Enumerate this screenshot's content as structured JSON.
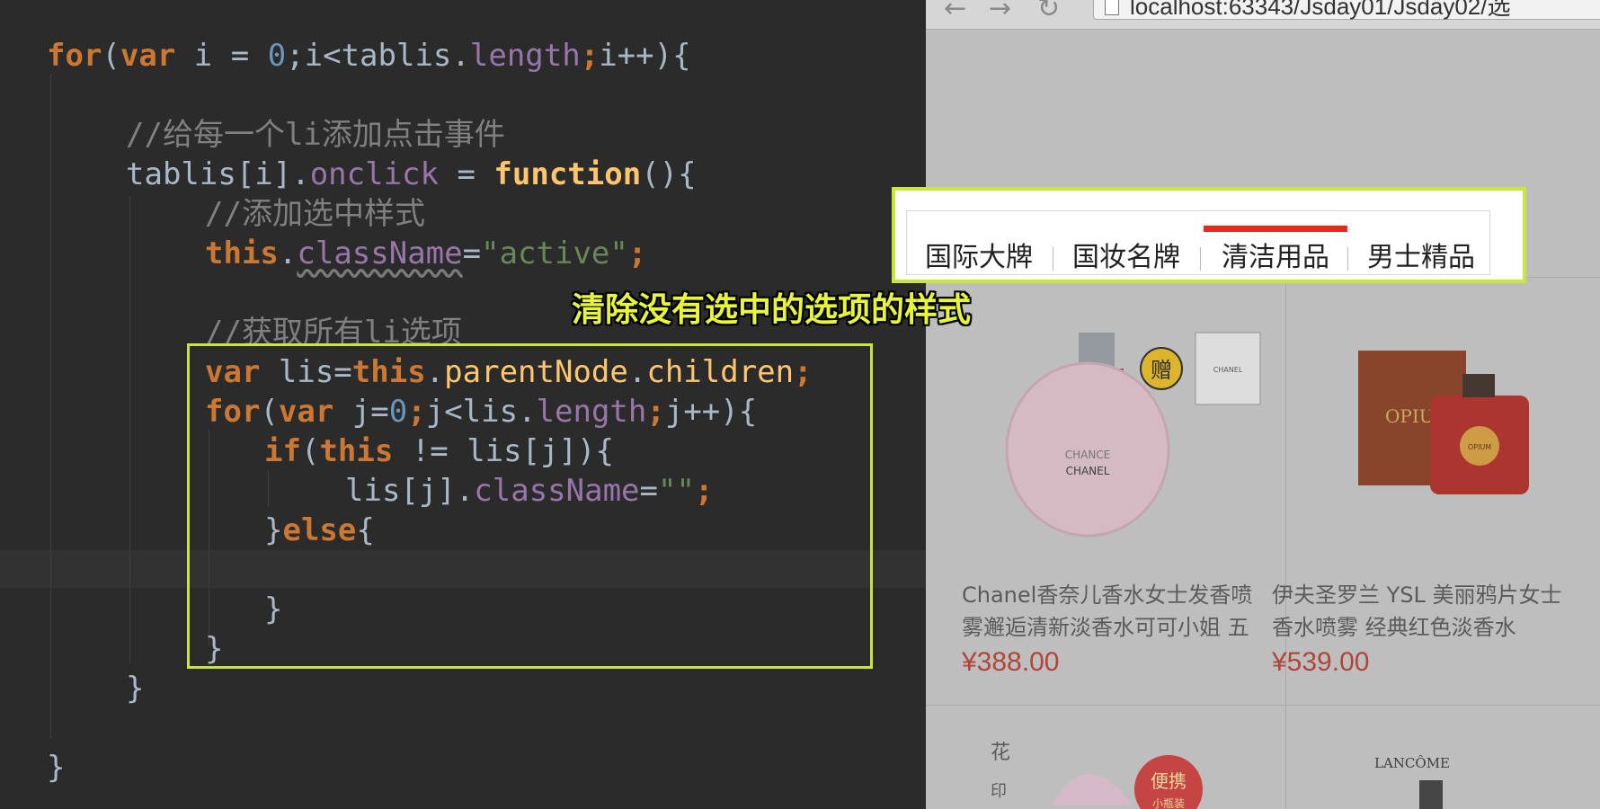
{
  "code_lines": [
    [
      "for(var i = 0;i<tablis.length;i++){"
    ],
    [
      "//给每一个li添加点击事件"
    ],
    [
      "tablis[i].onclick = function(){"
    ],
    [
      "//添加选中样式"
    ],
    [
      "this.className=\"active\";"
    ],
    [
      "//获取所有li选项"
    ],
    [
      "var lis=this.parentNode.children;"
    ],
    [
      "for(var j=0;j<lis.length;j++){"
    ],
    [
      "if(this != lis[j]){"
    ],
    [
      "lis[j].className=\"\";"
    ],
    [
      "}else{"
    ],
    [
      "}"
    ],
    [
      "}"
    ],
    [
      "}"
    ],
    [
      "}"
    ]
  ],
  "tokens": {
    "l1": [
      "for",
      "(",
      "var",
      " i = ",
      "0",
      ";i<tablis.",
      "length",
      ";",
      "i++){"
    ],
    "l2": [
      "//给每一个li添加点击事件"
    ],
    "l3": [
      "tablis[i].",
      "onclick",
      " = ",
      "function",
      "(){"
    ],
    "l4": [
      "//添加选中样式"
    ],
    "l5": [
      "this",
      ".",
      "className",
      "=",
      "\"active\"",
      ";"
    ],
    "l6": [
      "//获取所有li选项"
    ],
    "l7": [
      "var",
      " lis=",
      "this",
      ".",
      "parentNode",
      ".",
      "children",
      ";"
    ],
    "l8": [
      "for",
      "(",
      "var",
      " j=",
      "0",
      ";",
      "j<lis.",
      "length",
      ";",
      "j++){"
    ],
    "l9": [
      "if",
      "(",
      "this",
      " != lis[j]){"
    ],
    "l10": [
      "lis[j].",
      "className",
      "=",
      "\"\"",
      ";"
    ],
    "l11": [
      "}",
      "else",
      "{"
    ],
    "l12": [
      "}"
    ],
    "l13": [
      "}"
    ],
    "l14": [
      "}"
    ],
    "l15": [
      "}"
    ]
  },
  "caption": "清除没有选中的选项的样式",
  "browser": {
    "url": "localhost:63343/Jsday01/Jsday02/选",
    "back_icon": "back-arrow-icon",
    "forward_icon": "forward-arrow-icon",
    "reload_icon": "reload-icon"
  },
  "tabs": [
    {
      "label": "国际大牌",
      "active": false
    },
    {
      "label": "国妆名牌",
      "active": false
    },
    {
      "label": "清洁用品",
      "active": true
    },
    {
      "label": "男士精品",
      "active": false
    }
  ],
  "products": [
    {
      "title_line1": "Chanel香奈儿香水女士发香喷",
      "title_line2": "雾邂逅清新淡香水可可小姐 五",
      "price": "¥388.00",
      "badge": "赠",
      "bottle_text1": "CHANCE",
      "bottle_text2": "CHANEL",
      "bag_text": "CHANEL"
    },
    {
      "title_line1": "伊夫圣罗兰 YSL 美丽鸦片女士",
      "title_line2": "香水喷雾 经典红色淡香水",
      "price": "¥539.00",
      "box_text": "OPIU",
      "cap_text": "OPIUM"
    },
    {
      "top_text": "花",
      "sub_text": "印",
      "badge": "便携",
      "badge_sub": "小瓶装"
    },
    {
      "brand": "LANCÔME"
    }
  ],
  "colors": {
    "accent_box": "#c9e63a",
    "caption": "#e7f53b",
    "active_tab_bar": "#e8291b",
    "price": "#c0392b"
  }
}
